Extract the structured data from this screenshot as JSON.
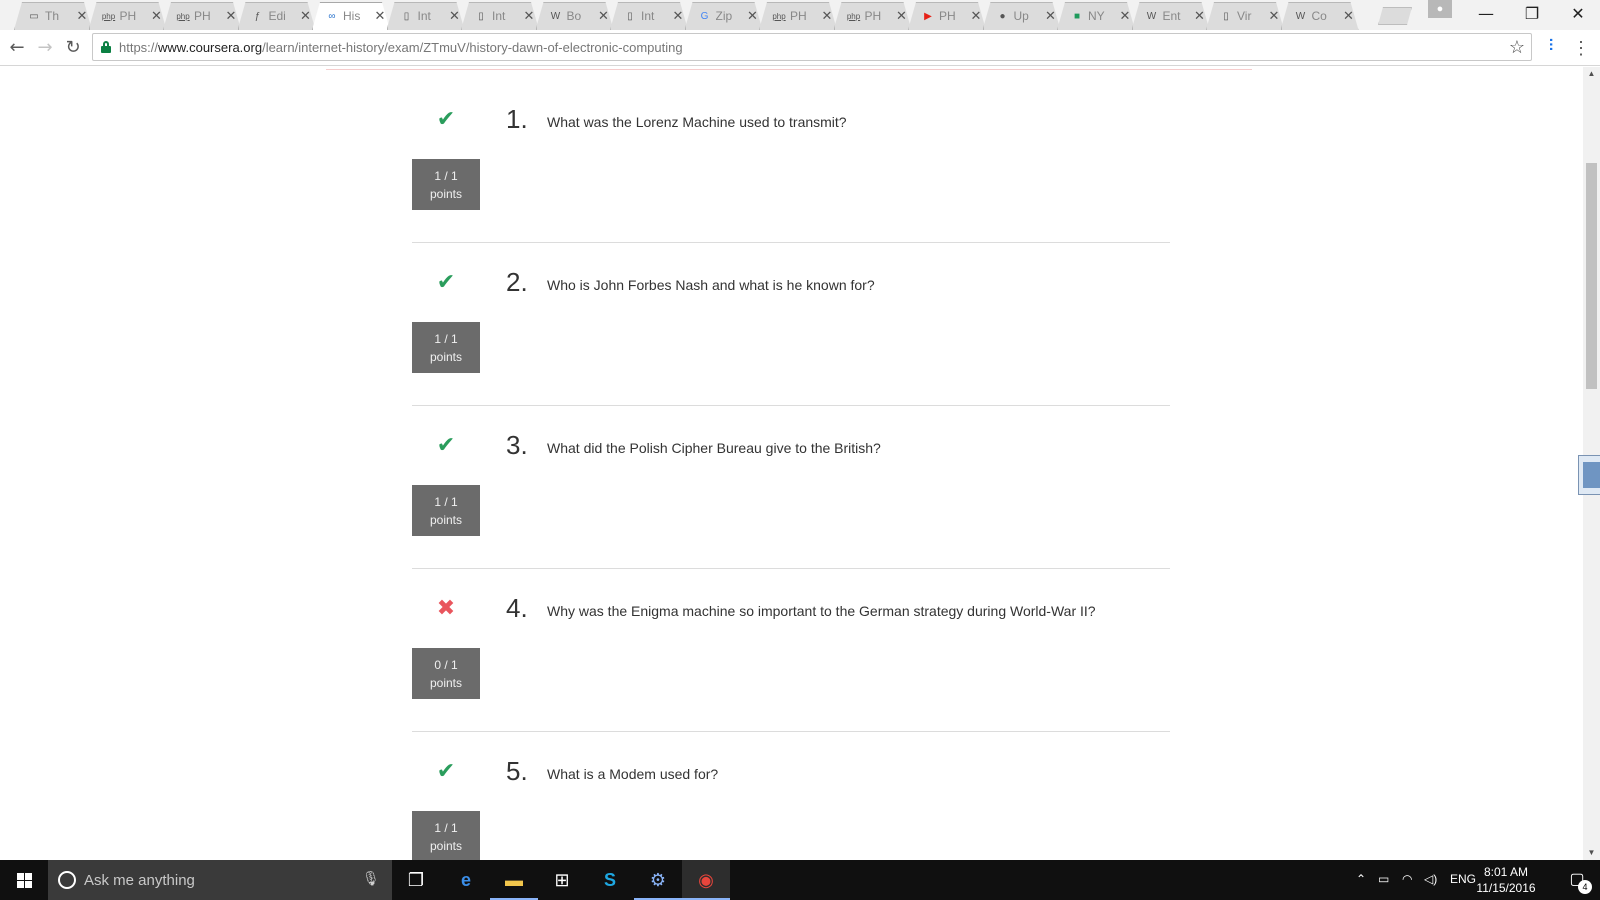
{
  "browser": {
    "tabs": [
      {
        "icon": "laptop-icon",
        "glyph": "▭",
        "title": "Th",
        "active": false
      },
      {
        "icon": "php-icon",
        "glyph": "php",
        "title": "PH",
        "active": false
      },
      {
        "icon": "php-icon",
        "glyph": "php",
        "title": "PH",
        "active": false
      },
      {
        "icon": "edit-icon",
        "glyph": "ƒ",
        "title": "Edi",
        "active": false
      },
      {
        "icon": "coursera-icon",
        "glyph": "∞",
        "title": "His",
        "active": true
      },
      {
        "icon": "document-icon",
        "glyph": "▯",
        "title": "Int",
        "active": false
      },
      {
        "icon": "document-icon",
        "glyph": "▯",
        "title": "Int",
        "active": false
      },
      {
        "icon": "wikipedia-icon",
        "glyph": "W",
        "title": "Bo",
        "active": false
      },
      {
        "icon": "document-icon",
        "glyph": "▯",
        "title": "Int",
        "active": false
      },
      {
        "icon": "google-icon",
        "glyph": "G",
        "title": "Zip",
        "active": false
      },
      {
        "icon": "php-icon",
        "glyph": "php",
        "title": "PH",
        "active": false
      },
      {
        "icon": "php-icon",
        "glyph": "php",
        "title": "PH",
        "active": false
      },
      {
        "icon": "youtube-icon",
        "glyph": "▶",
        "title": "PH",
        "active": false
      },
      {
        "icon": "apple-icon",
        "glyph": "●",
        "title": "Up",
        "active": false
      },
      {
        "icon": "nyt-icon",
        "glyph": "■",
        "title": "NY",
        "active": false
      },
      {
        "icon": "wikipedia-icon",
        "glyph": "W",
        "title": "Ent",
        "active": false
      },
      {
        "icon": "document-icon",
        "glyph": "▯",
        "title": "Vir",
        "active": false
      },
      {
        "icon": "wikipedia-icon",
        "glyph": "W",
        "title": "Co",
        "active": false
      }
    ],
    "url_scheme": "https://",
    "url_host": "www.coursera.org",
    "url_path": "/learn/internet-history/exam/ZTmuV/history-dawn-of-electronic-computing"
  },
  "quiz": {
    "questions": [
      {
        "number": "1.",
        "text": "What was the Lorenz Machine used to transmit?",
        "status": "correct",
        "score": "1 / 1",
        "unit": "points"
      },
      {
        "number": "2.",
        "text": "Who is John Forbes Nash and what is he known for?",
        "status": "correct",
        "score": "1 / 1",
        "unit": "points"
      },
      {
        "number": "3.",
        "text": "What did the Polish Cipher Bureau give to the British?",
        "status": "correct",
        "score": "1 / 1",
        "unit": "points"
      },
      {
        "number": "4.",
        "text": "Why was the Enigma machine so important to the German strategy during World-War II?",
        "status": "wrong",
        "score": "0 / 1",
        "unit": "points"
      },
      {
        "number": "5.",
        "text": "What is a Modem used for?",
        "status": "correct",
        "score": "1 / 1",
        "unit": "points"
      }
    ]
  },
  "taskbar": {
    "search_placeholder": "Ask me anything",
    "language": "ENG",
    "time": "8:01 AM",
    "date": "11/15/2016",
    "notification_count": "4"
  }
}
